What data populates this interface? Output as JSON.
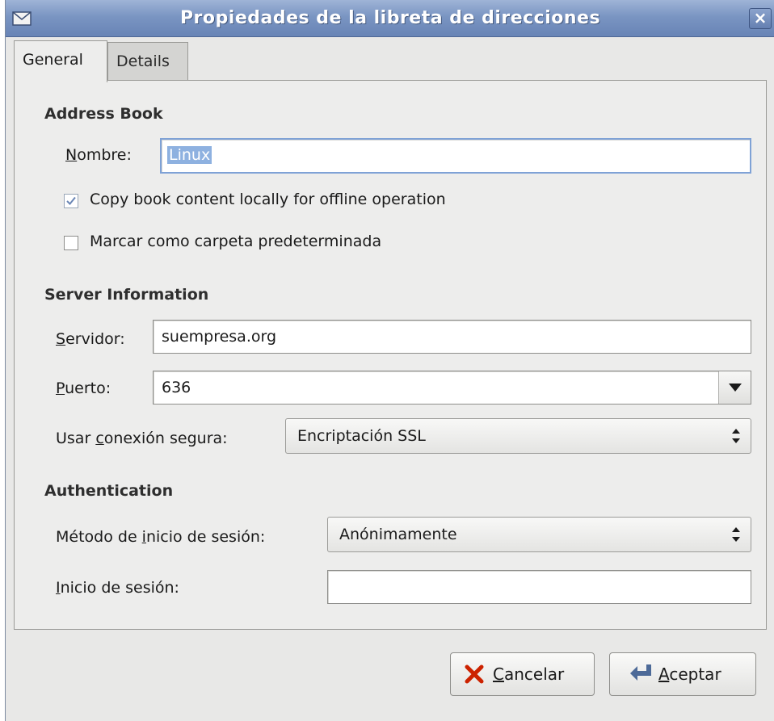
{
  "window": {
    "title": "Propiedades de la libreta de direcciones",
    "close_glyph": "×"
  },
  "tabs": [
    {
      "label": "General",
      "active": true
    },
    {
      "label": "Details",
      "active": false
    }
  ],
  "address_book": {
    "heading": "Address Book",
    "name_label_u": "N",
    "name_label_rest": "ombre:",
    "name_value": "Linux",
    "offline_checkbox": {
      "label": "Copy book content locally for offline operation",
      "checked": true
    },
    "default_checkbox": {
      "label": "Marcar como carpeta predeterminada",
      "checked": false
    }
  },
  "server": {
    "heading": "Server Information",
    "server_label_u": "S",
    "server_label_rest": "ervidor:",
    "server_value": "suempresa.org",
    "port_label_u": "P",
    "port_label_rest": "uerto:",
    "port_value": "636",
    "secure_label_pre": "Usar ",
    "secure_label_u": "c",
    "secure_label_rest": "onexión segura:",
    "secure_value": "Encriptación SSL"
  },
  "auth": {
    "heading": "Authentication",
    "method_label_pre": "Método de ",
    "method_label_u": "i",
    "method_label_rest": "nicio de sesión:",
    "method_value": "Anónimamente",
    "login_label_u": "I",
    "login_label_rest": "nicio de sesión:",
    "login_value": ""
  },
  "buttons": {
    "cancel_u": "C",
    "cancel_rest": "ancelar",
    "ok_u": "A",
    "ok_rest": "ceptar"
  },
  "colors": {
    "titlebar": "#7a95c2",
    "selection": "#8eb1e0",
    "focus_border": "#7fa2d6",
    "cancel_icon": "#cc2200"
  },
  "icons": {
    "window_menu": "envelope-icon",
    "cancel": "x-icon",
    "ok": "return-arrow-icon",
    "checkmark": "checkmark-icon"
  }
}
